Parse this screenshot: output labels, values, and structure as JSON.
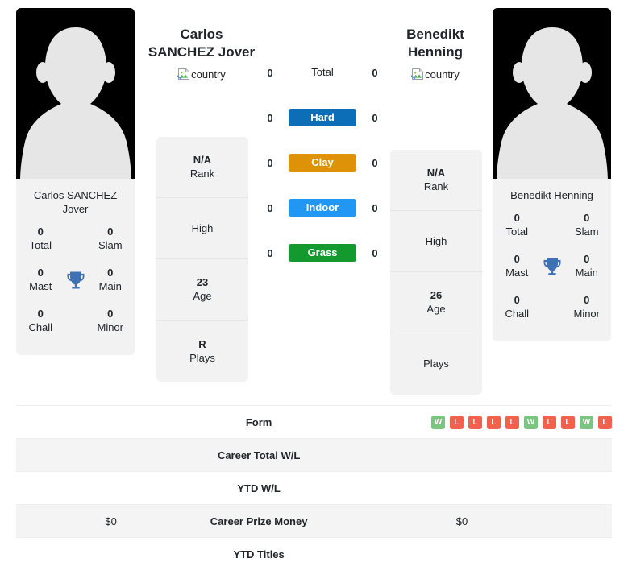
{
  "players": {
    "left": {
      "first_name": "Carlos",
      "last_name": "SANCHEZ Jover",
      "card_name": "Carlos SANCHEZ Jover",
      "flag_alt": "country",
      "titles": {
        "total_value": "0",
        "total_label": "Total",
        "slam_value": "0",
        "slam_label": "Slam",
        "mast_value": "0",
        "mast_label": "Mast",
        "main_value": "0",
        "main_label": "Main",
        "chall_value": "0",
        "chall_label": "Chall",
        "minor_value": "0",
        "minor_label": "Minor"
      },
      "info": {
        "rank_value": "N/A",
        "rank_label": "Rank",
        "high_value": "",
        "high_label": "High",
        "age_value": "23",
        "age_label": "Age",
        "plays_value": "R",
        "plays_label": "Plays"
      },
      "surface_values": {
        "total": "0",
        "hard": "0",
        "clay": "0",
        "indoor": "0",
        "grass": "0"
      },
      "career_prize_money": "$0",
      "career_total_wl": "",
      "ytd_wl": "",
      "ytd_titles": ""
    },
    "right": {
      "first_name": "Benedikt",
      "last_name": "Henning",
      "card_name": "Benedikt Henning",
      "flag_alt": "country",
      "titles": {
        "total_value": "0",
        "total_label": "Total",
        "slam_value": "0",
        "slam_label": "Slam",
        "mast_value": "0",
        "mast_label": "Mast",
        "main_value": "0",
        "main_label": "Main",
        "chall_value": "0",
        "chall_label": "Chall",
        "minor_value": "0",
        "minor_label": "Minor"
      },
      "info": {
        "rank_value": "N/A",
        "rank_label": "Rank",
        "high_value": "",
        "high_label": "High",
        "age_value": "26",
        "age_label": "Age",
        "plays_value": "",
        "plays_label": "Plays"
      },
      "surface_values": {
        "total": "0",
        "hard": "0",
        "clay": "0",
        "indoor": "0",
        "grass": "0"
      },
      "career_prize_money": "$0",
      "career_total_wl": "",
      "ytd_wl": "",
      "ytd_titles": ""
    }
  },
  "surfaces": [
    {
      "key": "total",
      "label": "Total",
      "color": "transparent"
    },
    {
      "key": "hard",
      "label": "Hard",
      "color": "#0d6eb8"
    },
    {
      "key": "clay",
      "label": "Clay",
      "color": "#dd9208"
    },
    {
      "key": "indoor",
      "label": "Indoor",
      "color": "#2196f3"
    },
    {
      "key": "grass",
      "label": "Grass",
      "color": "#14992f"
    }
  ],
  "table": {
    "rows": [
      {
        "label": "Form",
        "left": "",
        "right": ""
      },
      {
        "label": "Career Total W/L",
        "left": "",
        "right": ""
      },
      {
        "label": "YTD W/L",
        "left": "",
        "right": ""
      },
      {
        "label": "Career Prize Money",
        "left": "$0",
        "right": "$0"
      },
      {
        "label": "YTD Titles",
        "left": "",
        "right": ""
      }
    ]
  },
  "form": {
    "right_results": [
      "W",
      "L",
      "L",
      "L",
      "L",
      "W",
      "L",
      "L",
      "W",
      "L"
    ],
    "left_results": []
  },
  "colors": {
    "win": "#7ac57f",
    "loss": "#f1614b",
    "hard": "#0d6eb8",
    "clay": "#dd9208",
    "indoor": "#2196f3",
    "grass": "#14992f",
    "trophy": "#3f72b5",
    "card_bg": "#f2f2f2",
    "row_stripe": "#f4f4f4"
  }
}
